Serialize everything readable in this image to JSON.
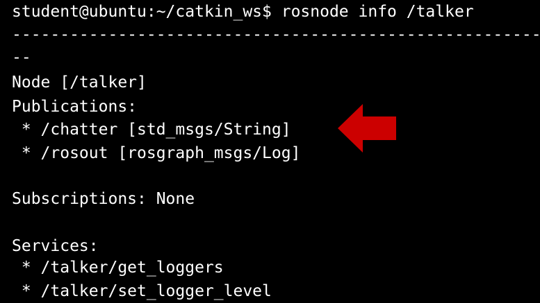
{
  "terminal": {
    "background": "#000000",
    "text_color": "#ffffff",
    "lines": [
      "student@ubuntu:~/catkin_ws$ rosnode info /talker",
      "--------------------------------------------------------------------------------",
      "--",
      "Node [/talker]",
      "Publications:",
      " * /chatter [std_msgs/String]",
      " * /rosout [rosgraph_msgs/Log]",
      "",
      "Subscriptions: None",
      "",
      "Services:",
      " * /talker/get_loggers",
      " * /talker/set_logger_level"
    ]
  },
  "annotation": {
    "icon": "arrow-left-icon",
    "color": "#cc0000",
    "points_to": " * /chatter [std_msgs/String]"
  }
}
